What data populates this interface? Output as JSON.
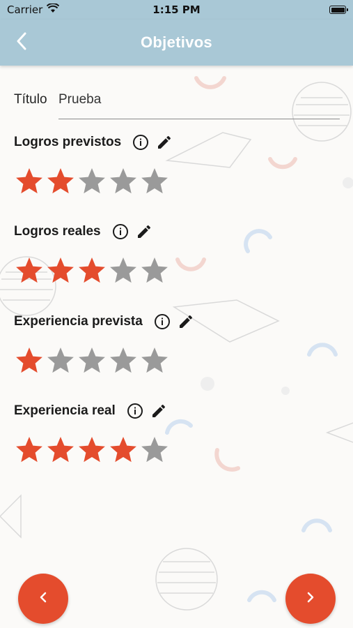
{
  "status_bar": {
    "carrier": "Carrier",
    "time": "1:15 PM"
  },
  "nav": {
    "title": "Objetivos",
    "back_icon": "chevron-left-icon"
  },
  "title_field": {
    "label": "Título",
    "value": "Prueba"
  },
  "sections": [
    {
      "label": "Logros previstos",
      "rating": 2,
      "max": 5
    },
    {
      "label": "Logros reales",
      "rating": 3,
      "max": 5
    },
    {
      "label": "Experiencia prevista",
      "rating": 1,
      "max": 5
    },
    {
      "label": "Experiencia real",
      "rating": 4,
      "max": 5
    }
  ],
  "colors": {
    "header": "#a9c8d6",
    "star_filled": "#e44c2d",
    "star_empty": "#9a9a9a",
    "fab": "#e44c2d"
  },
  "buttons": {
    "prev_icon": "chevron-left-icon",
    "next_icon": "chevron-right-icon"
  }
}
